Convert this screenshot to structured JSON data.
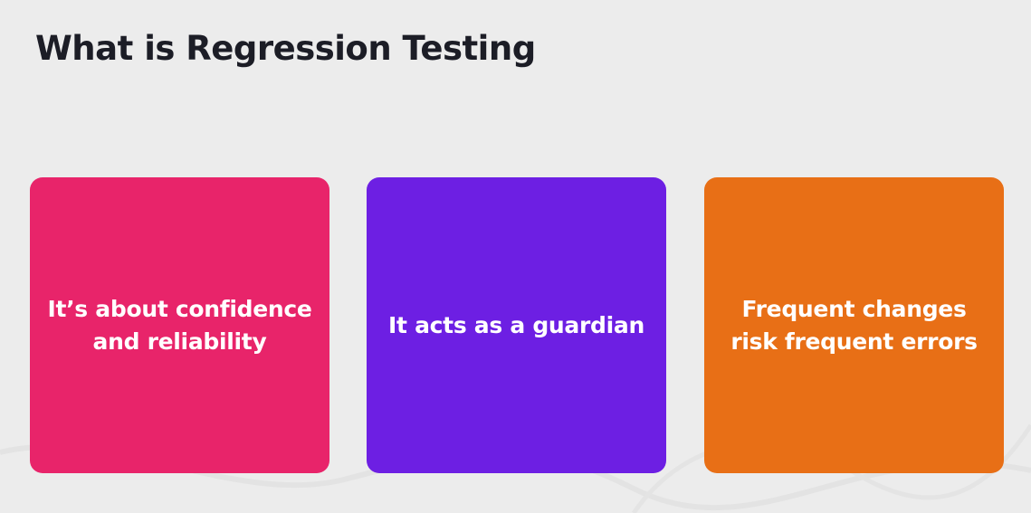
{
  "slide": {
    "title": "What is Regression Testing",
    "background_color": "#ececec",
    "title_color": "#1c1d26"
  },
  "cards": [
    {
      "lines": [
        "It’s about confidence",
        "and reliability"
      ],
      "color": "#e8246a"
    },
    {
      "lines": [
        "It acts as a guardian"
      ],
      "color": "#6d1fe3"
    },
    {
      "lines": [
        "Frequent changes",
        "risk frequent errors"
      ],
      "color": "#e86f16"
    }
  ]
}
